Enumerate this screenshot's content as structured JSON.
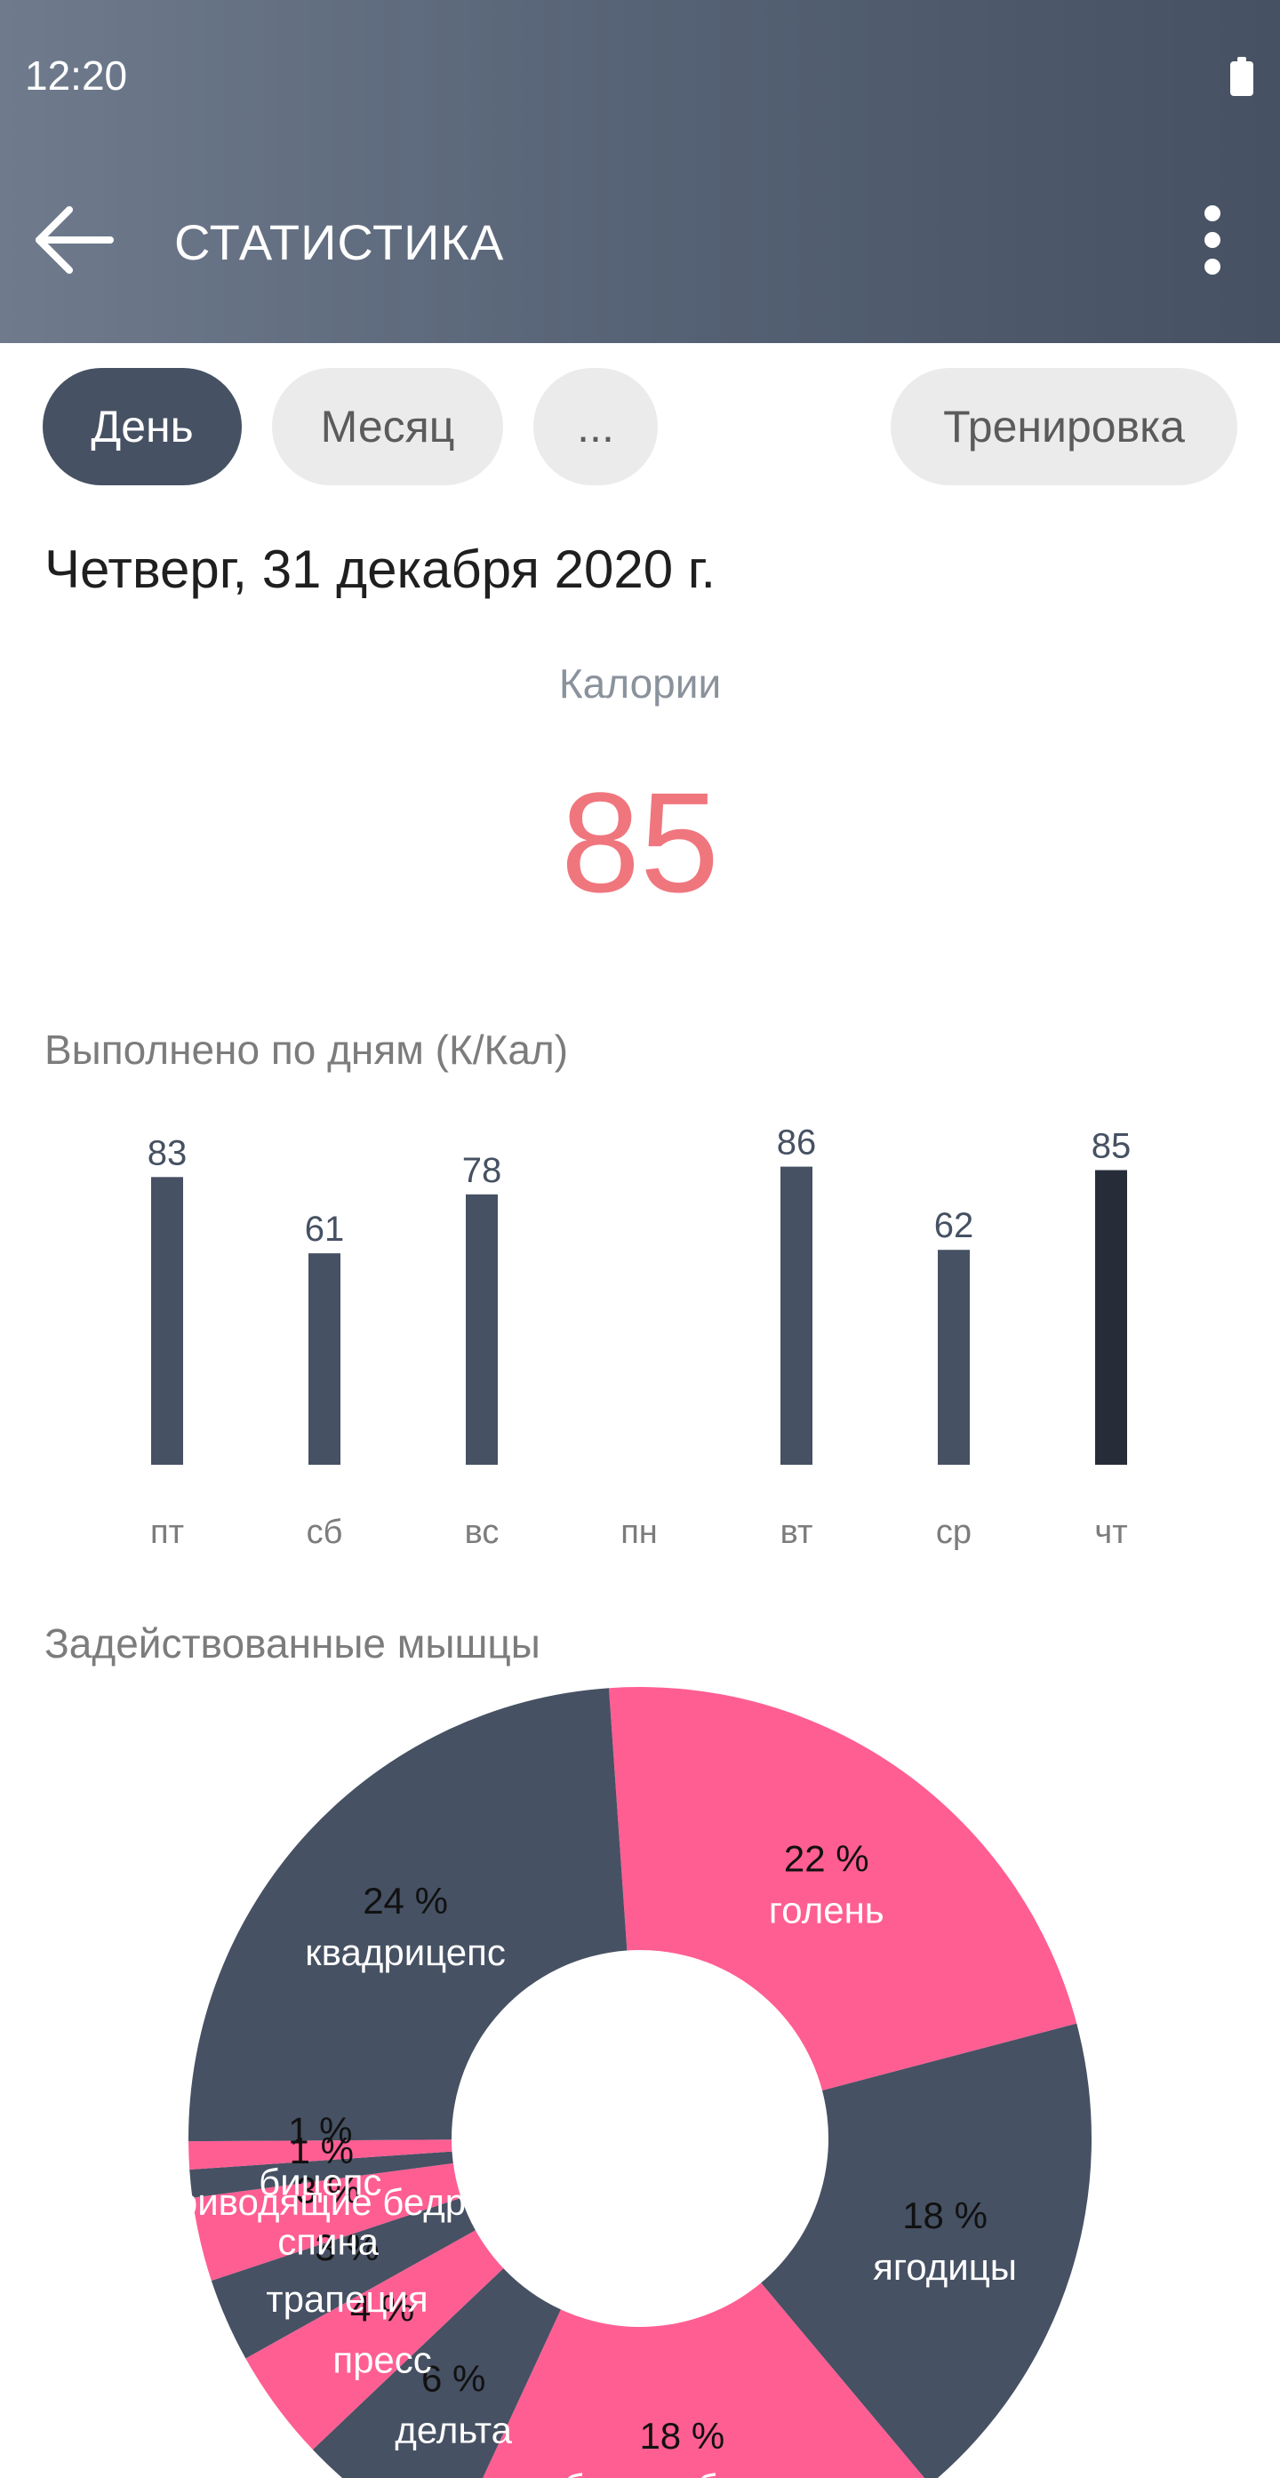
{
  "status_bar": {
    "time": "12:20",
    "battery_icon": "battery-full-icon"
  },
  "toolbar": {
    "title": "СТАТИСТИКА",
    "back_icon": "arrow-back-icon",
    "menu_icon": "more-vert-icon"
  },
  "tabs": [
    {
      "label": "День",
      "active": true
    },
    {
      "label": "Месяц",
      "active": false
    },
    {
      "label": "...",
      "active": false
    },
    {
      "label": "Тренировка",
      "active": false
    }
  ],
  "date": "Четверг, 31 декабря 2020 г.",
  "calories": {
    "label": "Калории",
    "value": "85",
    "color": "#f0767e"
  },
  "daily_section_title": "Выполнено по дням (К/Кал)",
  "muscles_section_title": "Задействованные мышцы",
  "colors": {
    "primary": "#465163",
    "highlight": "#262d38",
    "accent_pink": "#ff5e93",
    "chip_bg": "#ebebeb"
  },
  "chart_data": [
    {
      "type": "bar",
      "categories": [
        "пт",
        "сб",
        "вс",
        "пн",
        "вт",
        "ср",
        "чт"
      ],
      "values": [
        83,
        61,
        78,
        null,
        86,
        62,
        85
      ],
      "highlight_index": 6
    },
    {
      "type": "pie",
      "hole": true,
      "slices": [
        {
          "label": "голень",
          "value": 22,
          "text": "22 %",
          "color": "#ff5e93"
        },
        {
          "label": "ягодицы",
          "value": 18,
          "text": "18 %",
          "color": "#465163"
        },
        {
          "label": "бицепс бедра",
          "value": 18,
          "text": "18 %",
          "color": "#ff5e93"
        },
        {
          "label": "дельта",
          "value": 6,
          "text": "6 %",
          "color": "#465163"
        },
        {
          "label": "пресс",
          "value": 4,
          "text": "4 %",
          "color": "#ff5e93"
        },
        {
          "label": "трапеция",
          "value": 3,
          "text": "3 %",
          "color": "#465163"
        },
        {
          "label": "спина",
          "value": 3,
          "text": "3 %",
          "color": "#ff5e93"
        },
        {
          "label": "приводящие бедра",
          "value": 1,
          "text": "1 %",
          "color": "#465163"
        },
        {
          "label": "бицепс",
          "value": 1,
          "text": "1 %",
          "color": "#ff5e93"
        },
        {
          "label": "квадрицепс",
          "value": 24,
          "text": "24 %",
          "color": "#465163"
        }
      ]
    }
  ]
}
